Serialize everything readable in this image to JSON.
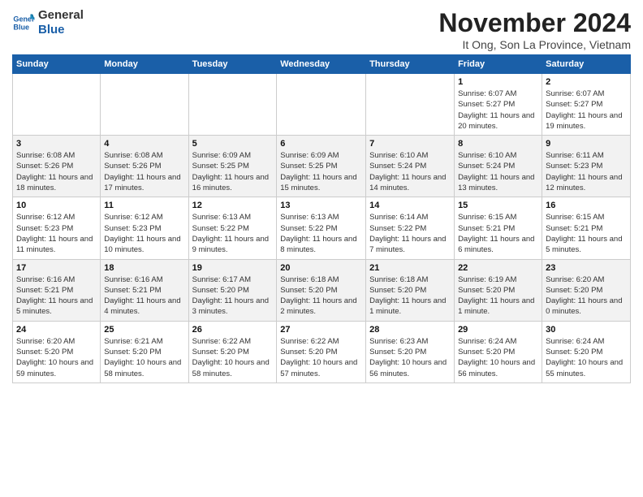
{
  "logo": {
    "line1": "General",
    "line2": "Blue"
  },
  "title": "November 2024",
  "subtitle": "It Ong, Son La Province, Vietnam",
  "days_of_week": [
    "Sunday",
    "Monday",
    "Tuesday",
    "Wednesday",
    "Thursday",
    "Friday",
    "Saturday"
  ],
  "weeks": [
    [
      {
        "day": "",
        "sunrise": "",
        "sunset": "",
        "daylight": ""
      },
      {
        "day": "",
        "sunrise": "",
        "sunset": "",
        "daylight": ""
      },
      {
        "day": "",
        "sunrise": "",
        "sunset": "",
        "daylight": ""
      },
      {
        "day": "",
        "sunrise": "",
        "sunset": "",
        "daylight": ""
      },
      {
        "day": "",
        "sunrise": "",
        "sunset": "",
        "daylight": ""
      },
      {
        "day": "1",
        "sunrise": "Sunrise: 6:07 AM",
        "sunset": "Sunset: 5:27 PM",
        "daylight": "Daylight: 11 hours and 20 minutes."
      },
      {
        "day": "2",
        "sunrise": "Sunrise: 6:07 AM",
        "sunset": "Sunset: 5:27 PM",
        "daylight": "Daylight: 11 hours and 19 minutes."
      }
    ],
    [
      {
        "day": "3",
        "sunrise": "Sunrise: 6:08 AM",
        "sunset": "Sunset: 5:26 PM",
        "daylight": "Daylight: 11 hours and 18 minutes."
      },
      {
        "day": "4",
        "sunrise": "Sunrise: 6:08 AM",
        "sunset": "Sunset: 5:26 PM",
        "daylight": "Daylight: 11 hours and 17 minutes."
      },
      {
        "day": "5",
        "sunrise": "Sunrise: 6:09 AM",
        "sunset": "Sunset: 5:25 PM",
        "daylight": "Daylight: 11 hours and 16 minutes."
      },
      {
        "day": "6",
        "sunrise": "Sunrise: 6:09 AM",
        "sunset": "Sunset: 5:25 PM",
        "daylight": "Daylight: 11 hours and 15 minutes."
      },
      {
        "day": "7",
        "sunrise": "Sunrise: 6:10 AM",
        "sunset": "Sunset: 5:24 PM",
        "daylight": "Daylight: 11 hours and 14 minutes."
      },
      {
        "day": "8",
        "sunrise": "Sunrise: 6:10 AM",
        "sunset": "Sunset: 5:24 PM",
        "daylight": "Daylight: 11 hours and 13 minutes."
      },
      {
        "day": "9",
        "sunrise": "Sunrise: 6:11 AM",
        "sunset": "Sunset: 5:23 PM",
        "daylight": "Daylight: 11 hours and 12 minutes."
      }
    ],
    [
      {
        "day": "10",
        "sunrise": "Sunrise: 6:12 AM",
        "sunset": "Sunset: 5:23 PM",
        "daylight": "Daylight: 11 hours and 11 minutes."
      },
      {
        "day": "11",
        "sunrise": "Sunrise: 6:12 AM",
        "sunset": "Sunset: 5:23 PM",
        "daylight": "Daylight: 11 hours and 10 minutes."
      },
      {
        "day": "12",
        "sunrise": "Sunrise: 6:13 AM",
        "sunset": "Sunset: 5:22 PM",
        "daylight": "Daylight: 11 hours and 9 minutes."
      },
      {
        "day": "13",
        "sunrise": "Sunrise: 6:13 AM",
        "sunset": "Sunset: 5:22 PM",
        "daylight": "Daylight: 11 hours and 8 minutes."
      },
      {
        "day": "14",
        "sunrise": "Sunrise: 6:14 AM",
        "sunset": "Sunset: 5:22 PM",
        "daylight": "Daylight: 11 hours and 7 minutes."
      },
      {
        "day": "15",
        "sunrise": "Sunrise: 6:15 AM",
        "sunset": "Sunset: 5:21 PM",
        "daylight": "Daylight: 11 hours and 6 minutes."
      },
      {
        "day": "16",
        "sunrise": "Sunrise: 6:15 AM",
        "sunset": "Sunset: 5:21 PM",
        "daylight": "Daylight: 11 hours and 5 minutes."
      }
    ],
    [
      {
        "day": "17",
        "sunrise": "Sunrise: 6:16 AM",
        "sunset": "Sunset: 5:21 PM",
        "daylight": "Daylight: 11 hours and 5 minutes."
      },
      {
        "day": "18",
        "sunrise": "Sunrise: 6:16 AM",
        "sunset": "Sunset: 5:21 PM",
        "daylight": "Daylight: 11 hours and 4 minutes."
      },
      {
        "day": "19",
        "sunrise": "Sunrise: 6:17 AM",
        "sunset": "Sunset: 5:20 PM",
        "daylight": "Daylight: 11 hours and 3 minutes."
      },
      {
        "day": "20",
        "sunrise": "Sunrise: 6:18 AM",
        "sunset": "Sunset: 5:20 PM",
        "daylight": "Daylight: 11 hours and 2 minutes."
      },
      {
        "day": "21",
        "sunrise": "Sunrise: 6:18 AM",
        "sunset": "Sunset: 5:20 PM",
        "daylight": "Daylight: 11 hours and 1 minute."
      },
      {
        "day": "22",
        "sunrise": "Sunrise: 6:19 AM",
        "sunset": "Sunset: 5:20 PM",
        "daylight": "Daylight: 11 hours and 1 minute."
      },
      {
        "day": "23",
        "sunrise": "Sunrise: 6:20 AM",
        "sunset": "Sunset: 5:20 PM",
        "daylight": "Daylight: 11 hours and 0 minutes."
      }
    ],
    [
      {
        "day": "24",
        "sunrise": "Sunrise: 6:20 AM",
        "sunset": "Sunset: 5:20 PM",
        "daylight": "Daylight: 10 hours and 59 minutes."
      },
      {
        "day": "25",
        "sunrise": "Sunrise: 6:21 AM",
        "sunset": "Sunset: 5:20 PM",
        "daylight": "Daylight: 10 hours and 58 minutes."
      },
      {
        "day": "26",
        "sunrise": "Sunrise: 6:22 AM",
        "sunset": "Sunset: 5:20 PM",
        "daylight": "Daylight: 10 hours and 58 minutes."
      },
      {
        "day": "27",
        "sunrise": "Sunrise: 6:22 AM",
        "sunset": "Sunset: 5:20 PM",
        "daylight": "Daylight: 10 hours and 57 minutes."
      },
      {
        "day": "28",
        "sunrise": "Sunrise: 6:23 AM",
        "sunset": "Sunset: 5:20 PM",
        "daylight": "Daylight: 10 hours and 56 minutes."
      },
      {
        "day": "29",
        "sunrise": "Sunrise: 6:24 AM",
        "sunset": "Sunset: 5:20 PM",
        "daylight": "Daylight: 10 hours and 56 minutes."
      },
      {
        "day": "30",
        "sunrise": "Sunrise: 6:24 AM",
        "sunset": "Sunset: 5:20 PM",
        "daylight": "Daylight: 10 hours and 55 minutes."
      }
    ]
  ]
}
